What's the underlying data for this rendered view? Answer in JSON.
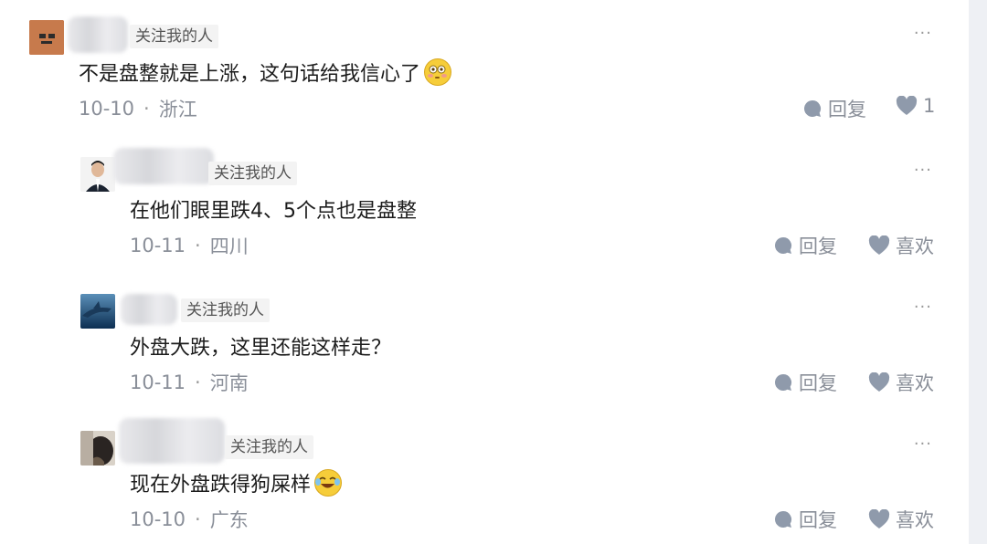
{
  "comments": [
    {
      "follow_tag": "关注我的人",
      "more": "···",
      "text": "不是盘整就是上涨，这句话给我信心了",
      "emoji_icon": "flushed-face-icon",
      "date": "10-10",
      "separator": "·",
      "location": "浙江",
      "reply_label": "回复",
      "like_label": "1"
    },
    {
      "follow_tag": "关注我的人",
      "more": "···",
      "text": "在他们眼里跌4、5个点也是盘整",
      "date": "10-11",
      "separator": "·",
      "location": "四川",
      "reply_label": "回复",
      "like_label": "喜欢"
    },
    {
      "follow_tag": "关注我的人",
      "more": "···",
      "text": "外盘大跌，这里还能这样走？",
      "date": "10-11",
      "separator": "·",
      "location": "河南",
      "reply_label": "回复",
      "like_label": "喜欢"
    },
    {
      "follow_tag": "关注我的人",
      "more": "···",
      "text": "现在外盘跌得狗屎样",
      "emoji_icon": "laughing-crying-face-icon",
      "date": "10-10",
      "separator": "·",
      "location": "广东",
      "reply_label": "回复",
      "like_label": "喜欢"
    }
  ],
  "colors": {
    "meta_gray": "#8a8f99",
    "icon_gray": "#8f9aab",
    "emoji_yellow": "#f6cd3a"
  }
}
